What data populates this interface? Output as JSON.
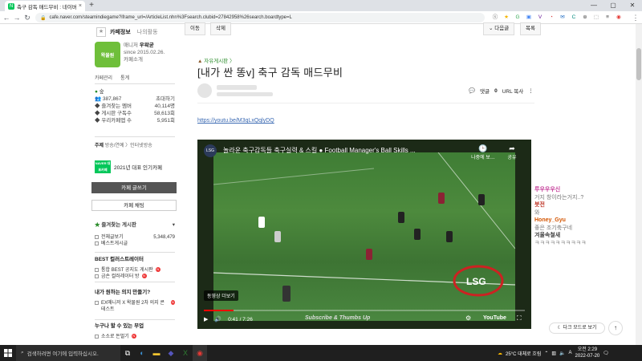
{
  "browser": {
    "tab_title": "축구 감독 매드무비 : 네이버 카페",
    "tab_close": "×",
    "new_tab": "+",
    "url": "cafe.naver.com/steamindiegame?iframe_url=/ArticleList.nhn%3Fsearch.clubid=27842958%26search.boardtype=L",
    "back": "←",
    "forward": "→",
    "reload": "↻",
    "home": "⌂",
    "lock": "🔒",
    "window_min": "—",
    "window_max": "▢",
    "window_close": "✕",
    "extensions": [
      "ⓢ",
      "★",
      "G",
      "▣",
      "V",
      "◔",
      "✉",
      "C",
      "⊕",
      "⬚",
      "≡",
      "◉"
    ],
    "extension_colors": [
      "#444",
      "#f4b400",
      "#34a853",
      "#4285f4",
      "#6a1b9a",
      "#d32f2f",
      "#1565c0",
      "#00897b",
      "#555",
      "#777",
      "#444",
      "#e53935"
    ],
    "menu": "⋮"
  },
  "sidebar": {
    "star": "★",
    "tab_cafe_info": "카페정보",
    "tab_my_activity": "나의활동",
    "manager_label": "매니저",
    "manager_name": "우왁굳",
    "since": "since 2015.02.26.",
    "cafe_intro": "카페소개",
    "avatar_text": "왁물원",
    "admin_link": "카페관리",
    "stats_link": "통계",
    "rank": "숲",
    "members": "387,867",
    "invite": "초대하기",
    "stats": [
      {
        "label": "즐겨찾는 멤버",
        "value": "40,114명"
      },
      {
        "label": "게시판 구독수",
        "value": "58,613회"
      },
      {
        "label": "우리카페앱 수",
        "value": "5,951회"
      }
    ],
    "theme_label": "주제",
    "theme_value": "방송/연예 〉인터넷방송",
    "naver_badge": "NAVER 대표카페",
    "popular_cafe": "2021년 대표 인기카페",
    "write_button": "카페 글쓰기",
    "chat_button": "카페 채팅",
    "favorites_title": "즐겨찾는 게시판",
    "favorites_toggle": "▾",
    "favorites": [
      {
        "label": "전체글보기",
        "count": "5,348,479"
      },
      {
        "label": "베스트게시글",
        "count": ""
      }
    ],
    "best_title": "BEST 컬러스트레이터",
    "best_items": [
      "통합 BEST 공지도 게시판",
      "금손 컬러레이터 방"
    ],
    "wish_title": "내가 원하는 의지 만들기?",
    "wish_items": [
      "EX매니저 X 왁물원 2차 의지 콘테스트"
    ],
    "who_title": "누구나 할 수 있는 부업",
    "who_items": [
      "소소로 돈벌기"
    ]
  },
  "article": {
    "btn_move": "이동",
    "btn_delete": "삭제",
    "btn_next": "다음글",
    "btn_list": "목록",
    "category": "자유게시판 〉",
    "title": "[내가 싼 똥v] 축구 감독 매드무비",
    "comments_label": "댓글",
    "comments_count": "0",
    "url_copy": "URL 복사",
    "more": "⋮",
    "youtube_link": "https://youtu.be/M3qLxQqlyDQ"
  },
  "video": {
    "channel_icon": "LSG",
    "title": "놀라운 축구감독들 축구실력 & 스킬 ● Football Manager's Ball Skills ...",
    "watch_later": "나중에 보…",
    "share": "공유",
    "more_videos": "동영상 더보기",
    "time": "0:41 / 7:26",
    "subscribe_text": "Subscribe & Thumbs Up",
    "logo": "YouTube",
    "progress": 0.092,
    "play_icon": "▶",
    "volume_icon": "🔊",
    "settings_icon": "⚙",
    "fullscreen_icon": "⛶"
  },
  "chat": [
    {
      "name": "루우우우신",
      "msg": "거지 창이라는거지..?",
      "color": "#c53f9a"
    },
    {
      "name": "봇전",
      "msg": "와",
      "color": "#c0392b"
    },
    {
      "name": "Honey_Gyu",
      "msg": "좋은 조기축구네",
      "color": "#d35400"
    },
    {
      "name": "겨울속철새",
      "msg": "ㅋㅋㅋㅋㅋㅋㅋㅋㅋㅋ",
      "color": "#444"
    }
  ],
  "footer": {
    "dark_mode": "다크 모드로 보기",
    "to_top": "↑"
  },
  "taskbar": {
    "search_placeholder": "검색하려면 여기에 입력하십시오.",
    "weather": "25°C 대체로 흐림",
    "time": "오전 2:29",
    "date": "2022-07-20",
    "lang": "A"
  }
}
